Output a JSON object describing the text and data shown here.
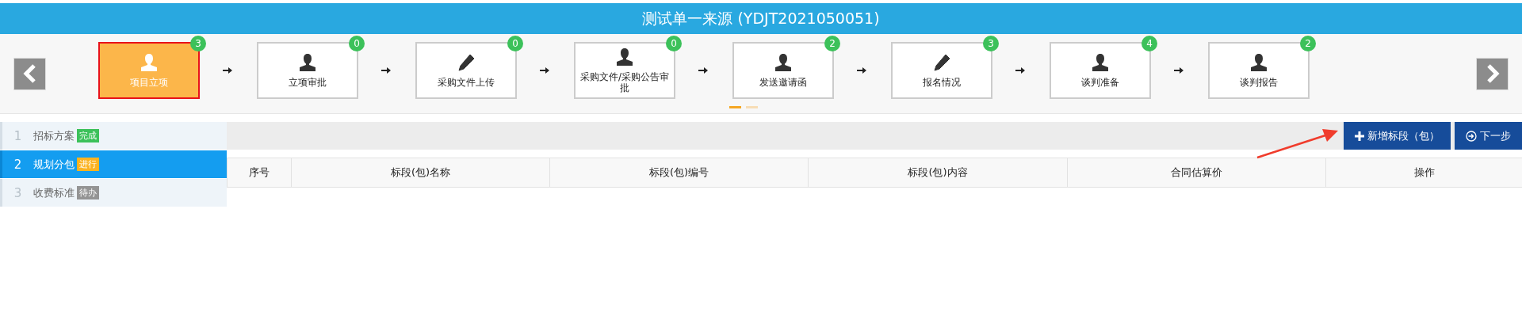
{
  "window": {
    "title": "测试单一来源 (YDJT2021050051)"
  },
  "steps": [
    {
      "label": "项目立项",
      "kind": "person",
      "count": "3",
      "selected": true
    },
    {
      "label": "立项审批",
      "kind": "person",
      "count": "0",
      "selected": false
    },
    {
      "label": "采购文件上传",
      "kind": "pencil",
      "count": "0",
      "selected": false
    },
    {
      "label": "采购文件/采购公告审批",
      "kind": "person",
      "count": "0",
      "selected": false
    },
    {
      "label": "发送邀请函",
      "kind": "person",
      "count": "2",
      "selected": false
    },
    {
      "label": "报名情况",
      "kind": "pencil",
      "count": "3",
      "selected": false
    },
    {
      "label": "谈判准备",
      "kind": "person",
      "count": "4",
      "selected": false
    },
    {
      "label": "谈判报告",
      "kind": "person",
      "count": "2",
      "selected": false
    }
  ],
  "pager": [
    {
      "selected": true
    },
    {
      "selected": false
    }
  ],
  "sidebar": {
    "items": [
      {
        "number": "1",
        "label": "招标方案",
        "status": "完成",
        "kind": "done",
        "selected": false
      },
      {
        "number": "2",
        "label": "规划分包",
        "status": "进行",
        "kind": "active",
        "selected": true
      },
      {
        "number": "3",
        "label": "收费标准",
        "status": "待办",
        "kind": "todo",
        "selected": false
      }
    ]
  },
  "toolbar": {
    "buttons": [
      {
        "label": "新增标段（包）",
        "kind": "add"
      },
      {
        "label": "下一步",
        "kind": "next"
      }
    ]
  },
  "table": {
    "columns": [
      "序号",
      "标段(包)名称",
      "标段(包)编号",
      "标段(包)内容",
      "合同估算价",
      "操作"
    ]
  }
}
